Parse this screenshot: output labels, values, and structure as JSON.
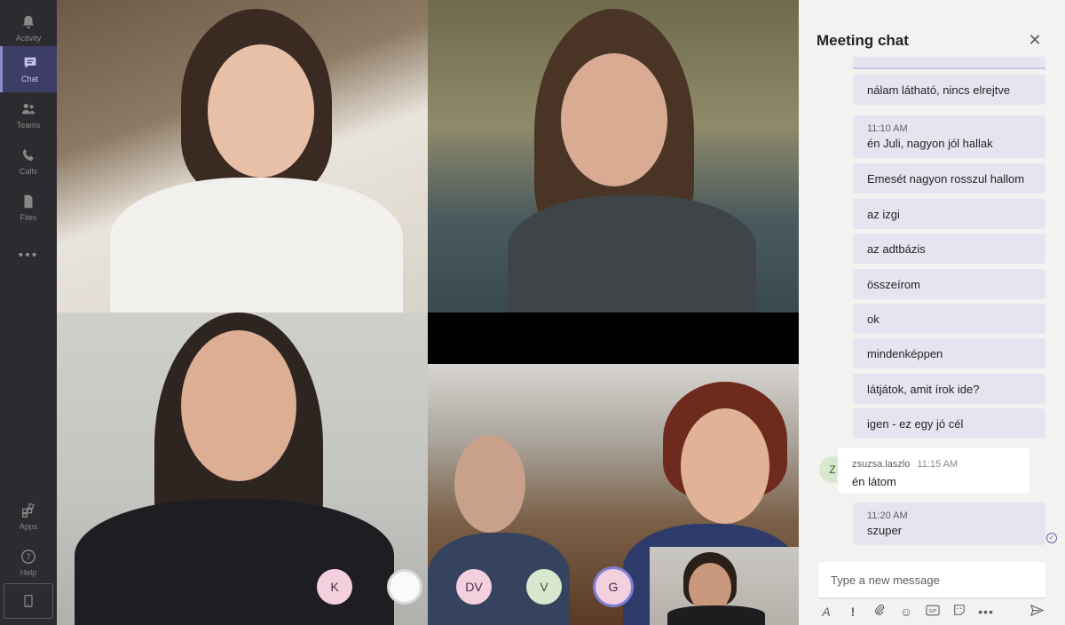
{
  "rail": {
    "items": [
      {
        "label": "Activity",
        "icon": "bell-icon"
      },
      {
        "label": "Chat",
        "icon": "chat-icon"
      },
      {
        "label": "Teams",
        "icon": "teams-icon"
      },
      {
        "label": "Calls",
        "icon": "phone-icon"
      },
      {
        "label": "Files",
        "icon": "file-icon"
      },
      {
        "label": "",
        "icon": "more-icon"
      },
      {
        "label": "Apps",
        "icon": "apps-icon"
      },
      {
        "label": "Help",
        "icon": "help-icon"
      }
    ],
    "active": "Chat"
  },
  "participants": {
    "avatars": [
      {
        "initials": "K"
      },
      {
        "initials": "DV"
      },
      {
        "initials": "V"
      },
      {
        "initials": "G"
      }
    ]
  },
  "chat": {
    "title": "Meeting chat",
    "messages": [
      {
        "time": "",
        "text": "nálam látható, nincs elrejtve"
      },
      {
        "time": "11:10 AM",
        "text": "én Juli, nagyon jól hallak"
      },
      {
        "time": "",
        "text": "Emesét nagyon rosszul hallom"
      },
      {
        "time": "",
        "text": "az izgi"
      },
      {
        "time": "",
        "text": "az adtbázis"
      },
      {
        "time": "",
        "text": "összeírom"
      },
      {
        "time": "",
        "text": "ok"
      },
      {
        "time": "",
        "text": "mindenképpen"
      },
      {
        "time": "",
        "text": "látjátok, amit írok ide?"
      },
      {
        "time": "",
        "text": "igen - ez egy jó cél"
      }
    ],
    "other_message": {
      "avatar_initial": "Z",
      "sender": "zsuzsa.laszlo",
      "time": "11:15 AM",
      "text": "én látom"
    },
    "last_message": {
      "time": "11:20 AM",
      "text": "szuper"
    },
    "compose_placeholder": "Type a new message"
  },
  "colors": {
    "accent": "#6264a7",
    "bubble": "#e5e5f1",
    "rail": "#2b2b30"
  }
}
